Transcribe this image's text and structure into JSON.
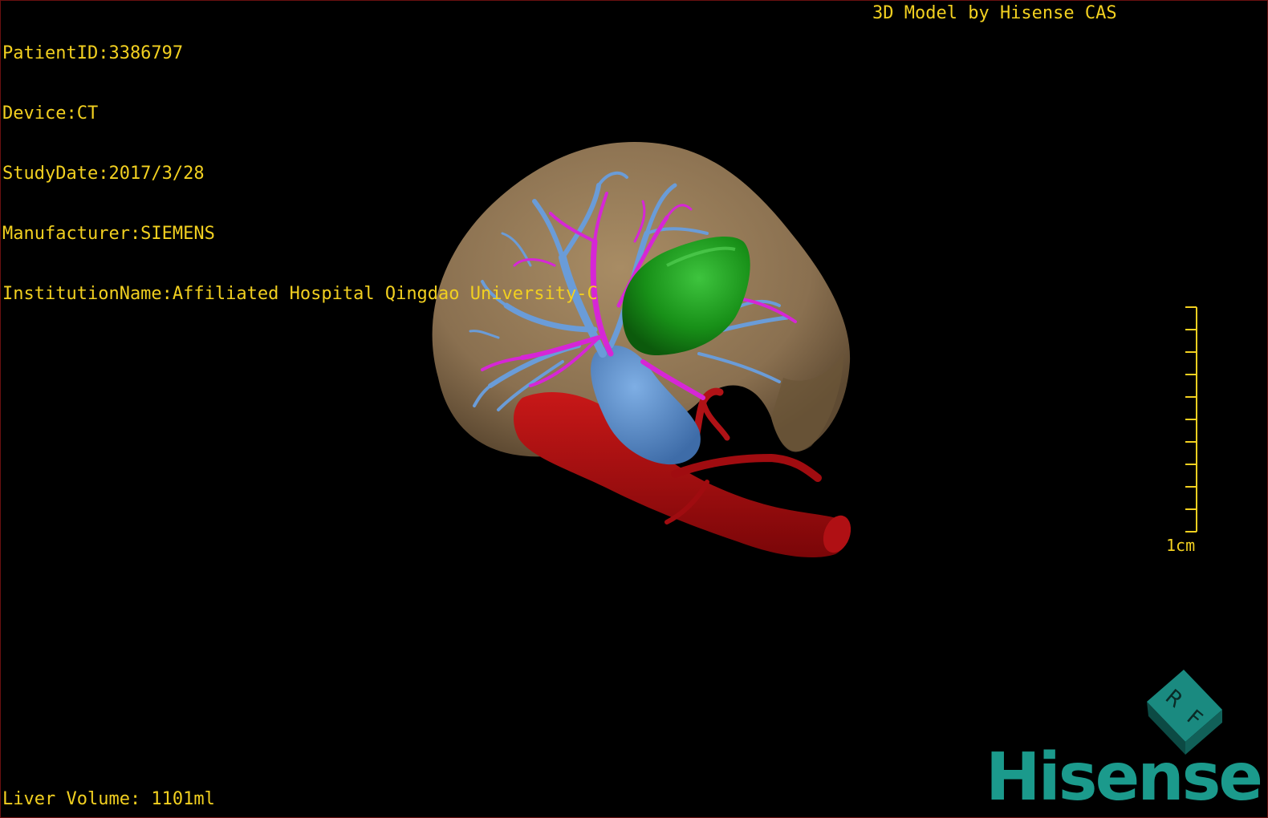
{
  "dicom_info": {
    "patient_id": "PatientID:3386797",
    "device": "Device:CT",
    "study_date": "StudyDate:2017/3/28",
    "manufacturer": "Manufacturer:SIEMENS",
    "institution": "InstitutionName:Affiliated Hospital Qingdao University-C"
  },
  "model_credit": "3D Model by Hisense CAS",
  "liver_volume": "Liver Volume: 1101ml",
  "scale": {
    "label": "1cm",
    "tick_count": 10
  },
  "orientation_cube": {
    "face_labels": [
      "R",
      "F"
    ]
  },
  "brand": {
    "name": "Hisense"
  },
  "colors": {
    "overlay_text": "#f2d020",
    "liver": "#8c7350",
    "portal_vein": "#5b8fd0",
    "hepatic_artery_branches": "#d020d0",
    "aorta": "#a00c10",
    "tumor": "#1a8a1a",
    "brand": "#1b9a8c"
  }
}
